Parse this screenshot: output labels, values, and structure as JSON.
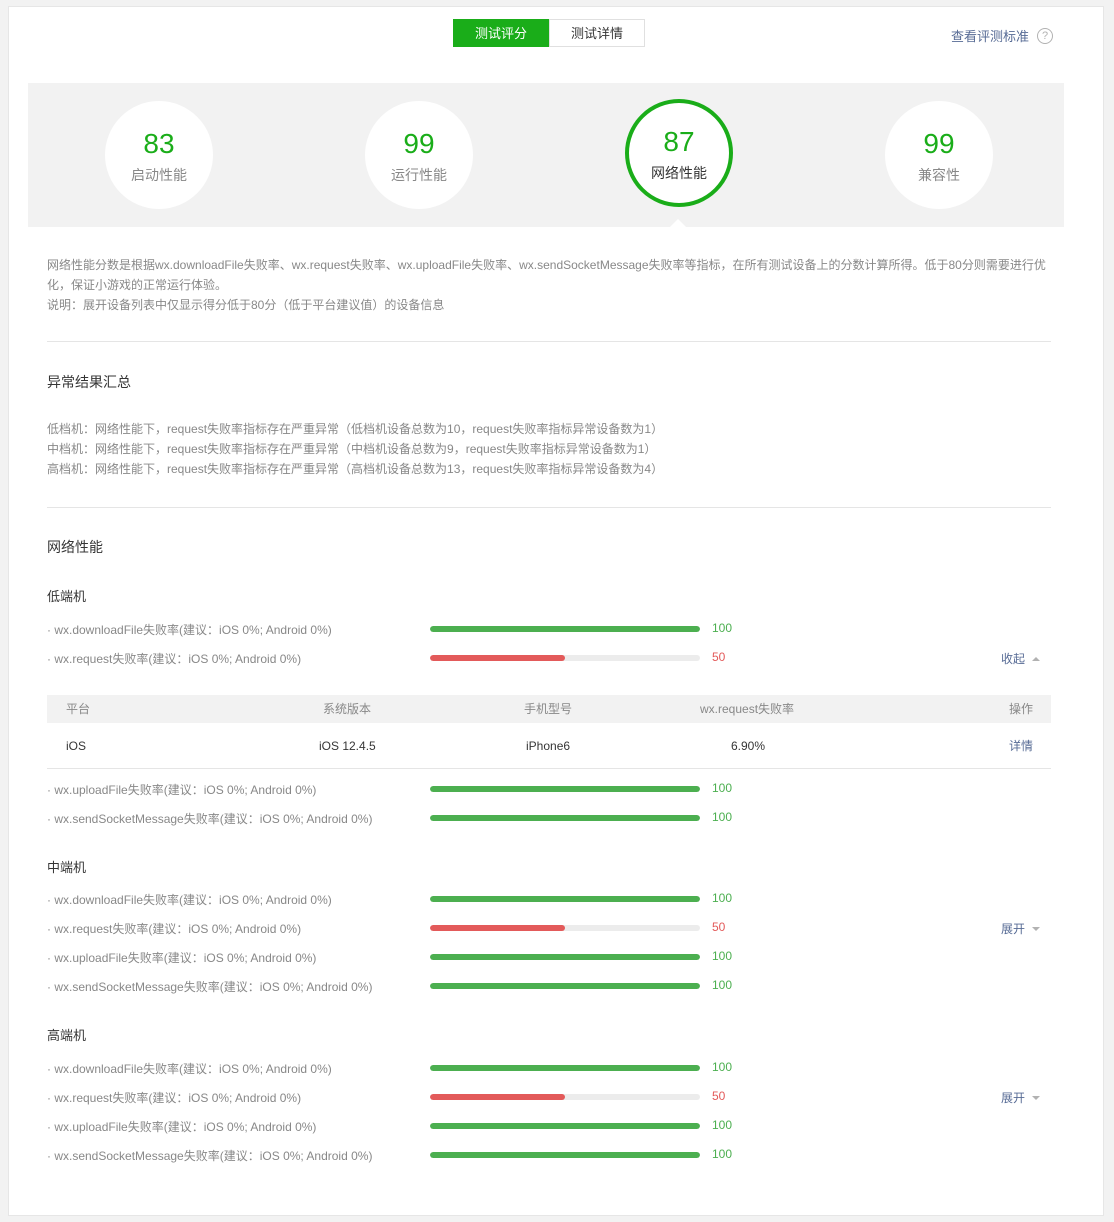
{
  "tabs": [
    {
      "label": "测试评分",
      "active": true
    },
    {
      "label": "测试详情",
      "active": false
    }
  ],
  "header_link": "查看评测标准",
  "help_glyph": "?",
  "scores": [
    {
      "value": "83",
      "label": "启动性能"
    },
    {
      "value": "99",
      "label": "运行性能"
    },
    {
      "value": "87",
      "label": "网络性能",
      "active": true
    },
    {
      "value": "99",
      "label": "兼容性"
    }
  ],
  "description": {
    "line1": "网络性能分数是根据wx.downloadFile失败率、wx.request失败率、wx.uploadFile失败率、wx.sendSocketMessage失败率等指标，在所有测试设备上的分数计算所得。低于80分则需要进行优化，保证小游戏的正常运行体验。",
    "line2": "说明：展开设备列表中仅显示得分低于80分（低于平台建议值）的设备信息"
  },
  "summary": {
    "title": "异常结果汇总",
    "lines": [
      "低档机：网络性能下，request失败率指标存在严重异常（低档机设备总数为10，request失败率指标异常设备数为1）",
      "中档机：网络性能下，request失败率指标存在严重异常（中档机设备总数为9，request失败率指标异常设备数为1）",
      "高档机：网络性能下，request失败率指标存在严重异常（高档机设备总数为13，request失败率指标异常设备数为4）"
    ]
  },
  "network": {
    "title": "网络性能",
    "tiers": [
      {
        "name": "低端机",
        "toggle": "收起",
        "metrics": [
          {
            "name": "· wx.downloadFile失败率(建议：iOS 0%; Android 0%)",
            "value": 100
          },
          {
            "name": "· wx.request失败率(建议：iOS 0%; Android 0%)",
            "value": 50
          },
          {
            "name": "· wx.uploadFile失败率(建议：iOS 0%; Android 0%)",
            "value": 100
          },
          {
            "name": "· wx.sendSocketMessage失败率(建议：iOS 0%; Android 0%)",
            "value": 100
          }
        ]
      },
      {
        "name": "中端机",
        "toggle": "展开",
        "metrics": [
          {
            "name": "· wx.downloadFile失败率(建议：iOS 0%; Android 0%)",
            "value": 100
          },
          {
            "name": "· wx.request失败率(建议：iOS 0%; Android 0%)",
            "value": 50
          },
          {
            "name": "· wx.uploadFile失败率(建议：iOS 0%; Android 0%)",
            "value": 100
          },
          {
            "name": "· wx.sendSocketMessage失败率(建议：iOS 0%; Android 0%)",
            "value": 100
          }
        ]
      },
      {
        "name": "高端机",
        "toggle": "展开",
        "metrics": [
          {
            "name": "· wx.downloadFile失败率(建议：iOS 0%; Android 0%)",
            "value": 100
          },
          {
            "name": "· wx.request失败率(建议：iOS 0%; Android 0%)",
            "value": 50
          },
          {
            "name": "· wx.uploadFile失败率(建议：iOS 0%; Android 0%)",
            "value": 100
          },
          {
            "name": "· wx.sendSocketMessage失败率(建议：iOS 0%; Android 0%)",
            "value": 100
          }
        ]
      }
    ]
  },
  "device_table": {
    "headers": [
      "平台",
      "系统版本",
      "手机型号",
      "wx.request失败率",
      "操作"
    ],
    "rows": [
      [
        "iOS",
        "iOS 12.4.5",
        "iPhone6",
        "6.90%",
        "详情"
      ]
    ]
  },
  "colors": {
    "good": "#4caf50",
    "bad": "#e35a5a",
    "accent": "#1aad19",
    "link": "#576b95"
  }
}
